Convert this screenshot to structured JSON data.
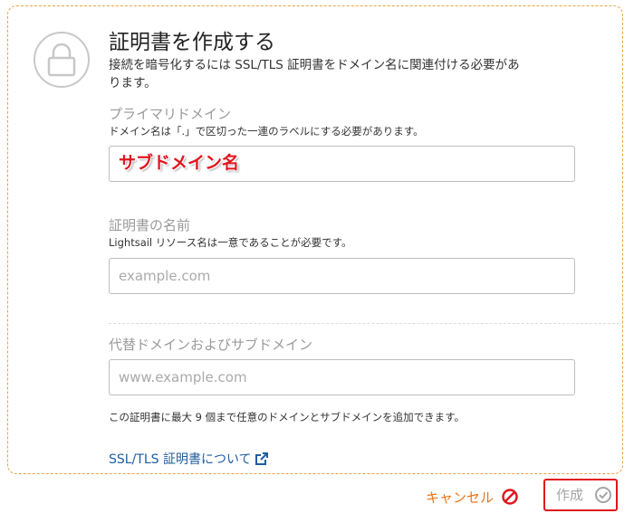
{
  "header": {
    "title": "証明書を作成する",
    "description": "接続を暗号化するには SSL/TLS 証明書をドメイン名に関連付ける必要があります。",
    "icon": "lock-icon"
  },
  "primary_domain": {
    "label": "プライマリドメイン",
    "help": "ドメイン名は「.」で区切った一連のラベルにする必要があります。",
    "value": "サブドメイン名"
  },
  "certificate_name": {
    "label": "証明書の名前",
    "help": "Lightsail リソース名は一意であることが必要です。",
    "placeholder": "example.com"
  },
  "alternate_domains": {
    "label": "代替ドメインおよびサブドメイン",
    "placeholder": "www.example.com",
    "note": "この証明書に最大 9 個まで任意のドメインとサブドメインを追加できます。"
  },
  "link": {
    "label": "SSL/TLS 証明書について",
    "icon": "external-link-icon"
  },
  "actions": {
    "cancel_label": "キャンセル",
    "cancel_icon": "prohibited-icon",
    "create_label": "作成",
    "create_icon": "check-circle-icon"
  },
  "colors": {
    "accent_orange": "#e8751a",
    "link_blue": "#1f5c9e",
    "highlight_red": "#e0161e"
  }
}
